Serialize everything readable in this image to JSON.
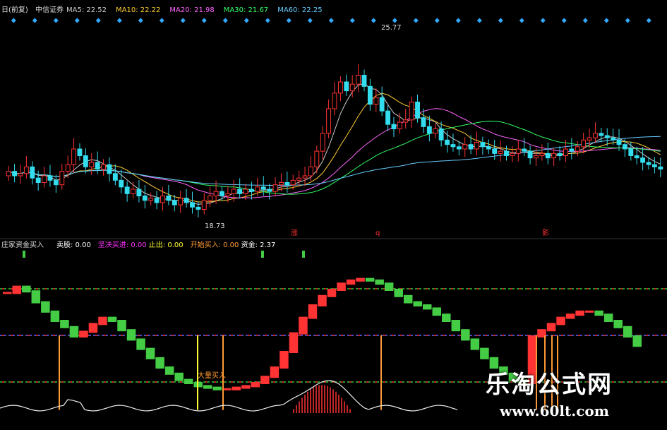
{
  "header": {
    "stock_name": "中信证券",
    "period_tag": "日(前复)",
    "ma_labels": [
      {
        "text": "MA5: 22.52",
        "color": "#cccccc"
      },
      {
        "text": "MA10: 22.22",
        "color": "#ffcc33"
      },
      {
        "text": "MA20: 21.98",
        "color": "#ff66ff"
      },
      {
        "text": "MA30: 21.67",
        "color": "#33ff66"
      },
      {
        "text": "MA60: 22.25",
        "color": "#66ccff"
      }
    ]
  },
  "indicator_header": {
    "title": "庄家资金买入",
    "items": [
      {
        "text": "卖股: 0.00",
        "color": "#ffffff"
      },
      {
        "text": "坚决买进: 0.00",
        "color": "#ff33ff"
      },
      {
        "text": "止出: 0.00",
        "color": "#ffff33"
      },
      {
        "text": "开始买入: 0.00",
        "color": "#ff9933"
      },
      {
        "text": "资金: 2.37",
        "color": "#ffffff"
      }
    ]
  },
  "annotations": {
    "high_price": "25.77",
    "low_price": "18.73",
    "markers": [
      "涨",
      "q",
      "影"
    ],
    "signal_text": "大量买入"
  },
  "watermark": {
    "title": "乐淘公式网",
    "url": "www.60lt.com"
  },
  "colors": {
    "up": "#ff3333",
    "down": "#33ddee",
    "green_curve": "#44cc44",
    "red_curve": "#ff3333",
    "orange_bar": "#ff9933",
    "yellow_bar": "#ffff33",
    "level_red": "#ff3333",
    "level_green": "#33cc33",
    "level_blue": "#6666ff",
    "diamond": "#33aaff"
  },
  "chart_data": [
    {
      "type": "candlestick",
      "title": "",
      "ylim": [
        18,
        27
      ],
      "series": [
        {
          "name": "MA5",
          "values": []
        },
        {
          "name": "MA10",
          "values": []
        },
        {
          "name": "MA20",
          "values": []
        },
        {
          "name": "MA30",
          "values": []
        },
        {
          "name": "MA60",
          "values": []
        }
      ],
      "close": [
        20.6,
        20.4,
        20.5,
        20.8,
        20.3,
        20.1,
        20.4,
        20.2,
        20.0,
        20.6,
        20.9,
        21.6,
        21.3,
        20.8,
        21.0,
        20.7,
        20.9,
        20.5,
        20.2,
        19.9,
        19.6,
        19.8,
        19.5,
        19.3,
        19.4,
        19.2,
        19.5,
        19.3,
        19.1,
        19.4,
        19.2,
        19.0,
        18.9,
        19.3,
        19.5,
        19.7,
        19.5,
        19.6,
        19.8,
        19.6,
        19.8,
        19.7,
        19.9,
        19.8,
        19.7,
        20.0,
        20.1,
        20.0,
        20.2,
        20.3,
        20.4,
        20.8,
        21.5,
        22.3,
        23.4,
        24.1,
        24.6,
        24.2,
        24.5,
        24.9,
        24.4,
        23.6,
        23.9,
        23.3,
        22.7,
        22.5,
        22.8,
        22.9,
        23.7,
        23.0,
        22.6,
        22.3,
        22.5,
        22.0,
        21.8,
        21.7,
        21.6,
        21.8,
        21.6,
        21.9,
        21.7,
        21.6,
        21.4,
        21.5,
        21.3,
        21.4,
        21.6,
        21.5,
        21.2,
        21.3,
        21.4,
        21.2,
        21.4,
        21.3,
        21.6,
        21.5,
        21.7,
        22.0,
        22.1,
        22.3,
        22.2,
        22.1,
        22.0,
        21.8,
        21.6,
        21.3,
        21.2,
        21.0,
        20.9,
        20.8,
        20.7
      ],
      "open": [
        20.4,
        20.6,
        20.4,
        20.5,
        20.8,
        20.3,
        20.1,
        20.4,
        20.2,
        20.0,
        20.6,
        20.9,
        21.6,
        21.3,
        20.8,
        21.0,
        20.7,
        20.9,
        20.5,
        20.2,
        19.9,
        19.6,
        19.8,
        19.5,
        19.3,
        19.4,
        19.2,
        19.5,
        19.3,
        19.1,
        19.4,
        19.2,
        19.0,
        18.9,
        19.3,
        19.5,
        19.7,
        19.5,
        19.6,
        19.8,
        19.6,
        19.8,
        19.7,
        19.9,
        19.8,
        19.7,
        20.0,
        20.1,
        20.0,
        20.2,
        20.3,
        20.4,
        20.8,
        21.5,
        22.3,
        23.4,
        24.1,
        24.6,
        24.2,
        24.5,
        24.9,
        24.4,
        23.6,
        23.9,
        23.3,
        22.7,
        22.5,
        22.8,
        22.9,
        23.7,
        23.0,
        22.6,
        22.3,
        22.5,
        22.0,
        21.8,
        21.7,
        21.6,
        21.8,
        21.6,
        21.9,
        21.7,
        21.6,
        21.4,
        21.5,
        21.3,
        21.4,
        21.6,
        21.5,
        21.2,
        21.3,
        21.4,
        21.2,
        21.4,
        21.3,
        21.6,
        21.5,
        21.7,
        22.0,
        22.1,
        22.3,
        22.2,
        22.1,
        22.0,
        21.8,
        21.6,
        21.3,
        21.2,
        21.0,
        20.9,
        20.8
      ]
    },
    {
      "type": "line",
      "title": "",
      "ylim": [
        0,
        100
      ],
      "levels": [
        80,
        50,
        20
      ],
      "oscillator": [
        78,
        82,
        79,
        72,
        66,
        60,
        56,
        50,
        53,
        58,
        62,
        60,
        54,
        48,
        42,
        36,
        30,
        26,
        22,
        20,
        18,
        17,
        16,
        16,
        17,
        18,
        20,
        24,
        30,
        40,
        52,
        62,
        70,
        76,
        80,
        84,
        86,
        87,
        86,
        84,
        80,
        76,
        72,
        70,
        68,
        64,
        60,
        54,
        48,
        42,
        36,
        30,
        26,
        22,
        20,
        50,
        54,
        58,
        62,
        64,
        66,
        66,
        64,
        60,
        56,
        50,
        44
      ],
      "oscillator_x": [
        0,
        1,
        2,
        3,
        4,
        5,
        6,
        7,
        8,
        9,
        10,
        11,
        12,
        13,
        14,
        15,
        16,
        17,
        18,
        19,
        20,
        21,
        22,
        23,
        24,
        25,
        26,
        27,
        28,
        29,
        30,
        31,
        32,
        33,
        34,
        35,
        36,
        37,
        38,
        39,
        40,
        41,
        42,
        43,
        44,
        45,
        46,
        47,
        48,
        49,
        50,
        51,
        52,
        53,
        54,
        55,
        56,
        57,
        58,
        59,
        60,
        61,
        62,
        63,
        64,
        65,
        66
      ]
    }
  ]
}
